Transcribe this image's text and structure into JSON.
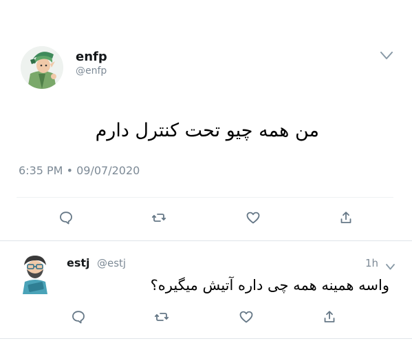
{
  "main_tweet": {
    "name": "enfp",
    "handle": "@enfp",
    "text": "من همه چیو تحت کنترل دارم",
    "time": "6:35 PM",
    "date": "09/07/2020",
    "avatar_icon": "elf-character-avatar"
  },
  "reply_tweet": {
    "name": "estj",
    "handle": "@estj",
    "time": "1h",
    "text": "واسه همینه همه چی داره آتیش میگیره؟",
    "avatar_icon": "bearded-character-avatar"
  },
  "actions": [
    "reply-icon",
    "retweet-icon",
    "like-icon",
    "share-icon"
  ],
  "colors": {
    "text": "#14171a",
    "muted": "#7d8a96",
    "divider": "#dfe4e8"
  }
}
